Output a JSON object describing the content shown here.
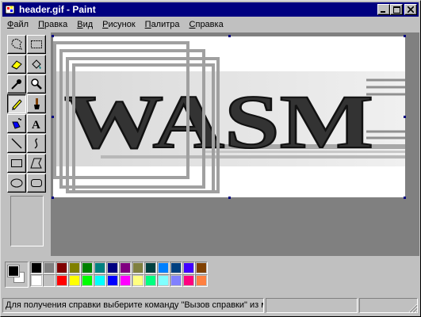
{
  "window": {
    "title": "header.gif - Paint",
    "buttons": {
      "minimize": "_",
      "maximize": "□",
      "close": "×"
    }
  },
  "menu": [
    {
      "label": "Файл",
      "accel": "Ф",
      "rest": "айл"
    },
    {
      "label": "Правка",
      "accel": "П",
      "rest": "равка"
    },
    {
      "label": "Вид",
      "accel": "В",
      "rest": "ид"
    },
    {
      "label": "Рисунок",
      "accel": "Р",
      "rest": "исунок"
    },
    {
      "label": "Палитра",
      "accel": "П",
      "rest": "алитра"
    },
    {
      "label": "Справка",
      "accel": "С",
      "rest": "правка"
    }
  ],
  "tools": [
    {
      "name": "free-select-icon",
      "pressed": false
    },
    {
      "name": "rect-select-icon",
      "pressed": false
    },
    {
      "name": "eraser-icon",
      "pressed": false
    },
    {
      "name": "fill-bucket-icon",
      "pressed": false
    },
    {
      "name": "color-picker-icon",
      "pressed": false
    },
    {
      "name": "magnifier-icon",
      "pressed": false
    },
    {
      "name": "pencil-icon",
      "pressed": true
    },
    {
      "name": "brush-icon",
      "pressed": false
    },
    {
      "name": "airbrush-icon",
      "pressed": false
    },
    {
      "name": "text-icon",
      "pressed": false
    },
    {
      "name": "line-icon",
      "pressed": false
    },
    {
      "name": "curve-icon",
      "pressed": false
    },
    {
      "name": "rectangle-icon",
      "pressed": false
    },
    {
      "name": "polygon-icon",
      "pressed": false
    },
    {
      "name": "ellipse-icon",
      "pressed": false
    },
    {
      "name": "rounded-rect-icon",
      "pressed": false
    }
  ],
  "canvas": {
    "image_text": "WASM"
  },
  "colors": {
    "foreground": "#000000",
    "background": "#ffffff",
    "palette_top": [
      "#000000",
      "#808080",
      "#800000",
      "#808000",
      "#008000",
      "#008080",
      "#000080",
      "#800080",
      "#808040",
      "#004040",
      "#0080ff",
      "#004080",
      "#4000ff",
      "#804000"
    ],
    "palette_bottom": [
      "#ffffff",
      "#c0c0c0",
      "#ff0000",
      "#ffff00",
      "#00ff00",
      "#00ffff",
      "#0000ff",
      "#ff00ff",
      "#ffff80",
      "#00ff80",
      "#80ffff",
      "#8080ff",
      "#ff0080",
      "#ff8040"
    ]
  },
  "status": {
    "help": "Для получения справки выберите команду \"Вызов справки\" из меню \"Справка\".",
    "coords": "",
    "size": ""
  }
}
